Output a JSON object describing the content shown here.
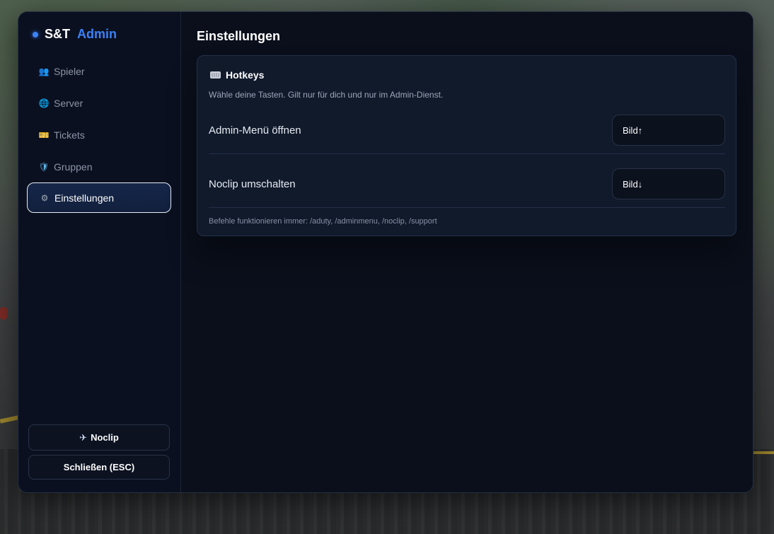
{
  "brand": {
    "name_part1": "S&T",
    "name_part2": "Admin",
    "accent": "#3b82f6"
  },
  "sidebar": {
    "items": [
      {
        "label": "Spieler",
        "icon": "people-icon",
        "active": false
      },
      {
        "label": "Server",
        "icon": "globe-icon",
        "active": false
      },
      {
        "label": "Tickets",
        "icon": "ticket-icon",
        "active": false
      },
      {
        "label": "Gruppen",
        "icon": "shield-icon",
        "active": false
      },
      {
        "label": "Einstellungen",
        "icon": "gear-icon",
        "active": true
      }
    ],
    "buttons": {
      "noclip_label": "Noclip",
      "noclip_icon": "airplane-icon",
      "close_label": "Schließen (ESC)"
    }
  },
  "main": {
    "title": "Einstellungen",
    "hotkeys": {
      "title": "Hotkeys",
      "icon": "keyboard-icon",
      "description": "Wähle deine Tasten. Gilt nur für dich und nur im Admin-Dienst.",
      "rows": [
        {
          "label": "Admin-Menü öffnen",
          "value": "Bild↑"
        },
        {
          "label": "Noclip umschalten",
          "value": "Bild↓"
        }
      ],
      "footer": "Befehle funktionieren immer: /aduty, /adminmenu, /noclip, /support"
    }
  }
}
